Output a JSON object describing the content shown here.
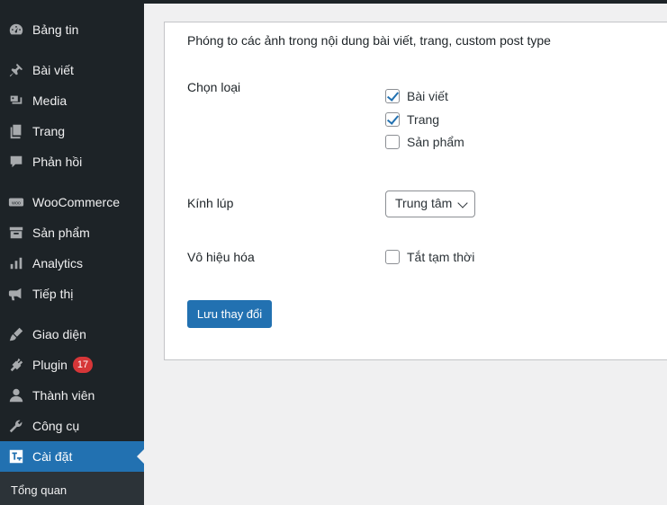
{
  "sidebar": {
    "items": [
      {
        "label": "Bảng tin",
        "icon": "dashboard-icon"
      },
      {
        "label": "Bài viết",
        "icon": "pin-icon"
      },
      {
        "label": "Media",
        "icon": "media-icon"
      },
      {
        "label": "Trang",
        "icon": "page-icon"
      },
      {
        "label": "Phản hồi",
        "icon": "comment-icon"
      },
      {
        "label": "WooCommerce",
        "icon": "woo-icon"
      },
      {
        "label": "Sản phẩm",
        "icon": "archive-icon"
      },
      {
        "label": "Analytics",
        "icon": "chart-bar-icon"
      },
      {
        "label": "Tiếp thị",
        "icon": "megaphone-icon"
      },
      {
        "label": "Giao diện",
        "icon": "brush-icon"
      },
      {
        "label": "Plugin",
        "icon": "plugin-icon",
        "badge": "17"
      },
      {
        "label": "Thành viên",
        "icon": "user-icon"
      },
      {
        "label": "Công cụ",
        "icon": "wrench-icon"
      },
      {
        "label": "Cài đặt",
        "icon": "settings-icon",
        "active": true
      }
    ],
    "submenu": {
      "label": "Tổng quan"
    }
  },
  "content": {
    "title": "Phóng to các ảnh trong nội dung bài viết, trang, custom post type",
    "select_type": {
      "label": "Chọn loại",
      "options": [
        {
          "label": "Bài viết",
          "checked": true
        },
        {
          "label": "Trang",
          "checked": true
        },
        {
          "label": "Sản phẩm",
          "checked": false
        }
      ]
    },
    "magnifier": {
      "label": "Kính lúp",
      "value": "Trung tâm"
    },
    "disable": {
      "label": "Vô hiệu hóa",
      "option_label": "Tắt tạm thời",
      "checked": false
    },
    "save_label": "Lưu thay đổi"
  },
  "colors": {
    "sidebar_bg": "#1d2327",
    "accent": "#2271b1",
    "badge": "#d63638",
    "page_bg": "#f0f0f1"
  }
}
